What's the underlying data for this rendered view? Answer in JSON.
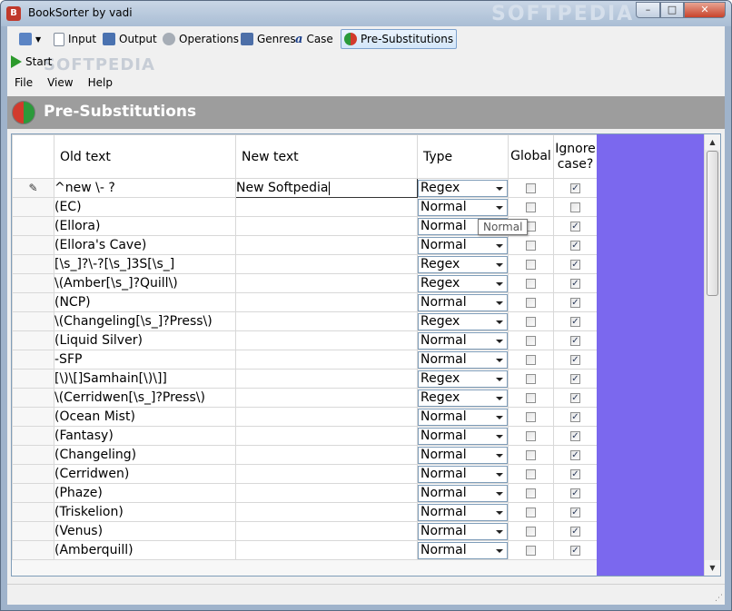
{
  "window": {
    "title": "BookSorter by vadi",
    "watermark": "SOFTPEDIA",
    "buttons": {
      "minimize": "–",
      "maximize": "□",
      "close": "✕"
    }
  },
  "toolbar": {
    "items": [
      {
        "label": "",
        "icon": "disk-icon"
      },
      {
        "label": "Input",
        "icon": "document-icon"
      },
      {
        "label": "Output",
        "icon": "output-icon"
      },
      {
        "label": "Operations",
        "icon": "gear-icon"
      },
      {
        "label": "Genres",
        "icon": "genres-icon"
      },
      {
        "label": "Case",
        "icon": "case-icon"
      },
      {
        "label": "Pre-Substitutions",
        "icon": "substitution-icon",
        "active": true
      }
    ],
    "start_label": "Start",
    "watermark": "SOFTPEDIA"
  },
  "menu": {
    "items": [
      "File",
      "View",
      "Help"
    ]
  },
  "banner": {
    "title": "Pre-Substitutions"
  },
  "grid": {
    "columns": {
      "old": "Old text",
      "new": "New text",
      "type": "Type",
      "global": "Global",
      "ignore": "Ignore case?"
    },
    "edit_marker": "✎",
    "rows": [
      {
        "old": "^new \\- ?",
        "new": "New Softpedia",
        "type": "Regex",
        "global": false,
        "ignore": true,
        "editing": true
      },
      {
        "old": " (EC)",
        "new": "",
        "type": "Normal",
        "global": false,
        "ignore": false
      },
      {
        "old": " (Ellora)",
        "new": "",
        "type": "Normal",
        "global": false,
        "ignore": true
      },
      {
        "old": " (Ellora's Cave)",
        "new": "",
        "type": "Normal",
        "global": false,
        "ignore": true
      },
      {
        "old": "[\\s_]?\\-?[\\s_]3S[\\s_]",
        "new": "",
        "type": "Regex",
        "global": false,
        "ignore": true
      },
      {
        "old": "\\(Amber[\\s_]?Quill\\)",
        "new": "",
        "type": "Regex",
        "global": false,
        "ignore": true
      },
      {
        "old": "(NCP)",
        "new": "",
        "type": "Normal",
        "global": false,
        "ignore": true
      },
      {
        "old": "\\(Changeling[\\s_]?Press\\)",
        "new": "",
        "type": "Regex",
        "global": false,
        "ignore": true
      },
      {
        "old": "(Liquid Silver)",
        "new": "",
        "type": "Normal",
        "global": false,
        "ignore": true
      },
      {
        "old": "-SFP",
        "new": "",
        "type": "Normal",
        "global": false,
        "ignore": true
      },
      {
        "old": "[\\)\\[]Samhain[\\)\\]]",
        "new": "",
        "type": "Regex",
        "global": false,
        "ignore": true
      },
      {
        "old": "\\(Cerridwen[\\s_]?Press\\)",
        "new": "",
        "type": "Regex",
        "global": false,
        "ignore": true
      },
      {
        "old": "(Ocean Mist)",
        "new": "",
        "type": "Normal",
        "global": false,
        "ignore": true
      },
      {
        "old": "(Fantasy)",
        "new": "",
        "type": "Normal",
        "global": false,
        "ignore": true
      },
      {
        "old": "(Changeling)",
        "new": "",
        "type": "Normal",
        "global": false,
        "ignore": true
      },
      {
        "old": "(Cerridwen)",
        "new": "",
        "type": "Normal",
        "global": false,
        "ignore": true
      },
      {
        "old": "(Phaze)",
        "new": "",
        "type": "Normal",
        "global": false,
        "ignore": true
      },
      {
        "old": "(Triskelion)",
        "new": "",
        "type": "Normal",
        "global": false,
        "ignore": true
      },
      {
        "old": "(Venus)",
        "new": "",
        "type": "Normal",
        "global": false,
        "ignore": true
      },
      {
        "old": "(Amberquill)",
        "new": "",
        "type": "Normal",
        "global": false,
        "ignore": true
      }
    ]
  },
  "tooltip": {
    "text": "Normal"
  },
  "colors": {
    "banner": "#9d9d9d",
    "filler": "#7b68ee",
    "titlebar": "#b9cade"
  }
}
